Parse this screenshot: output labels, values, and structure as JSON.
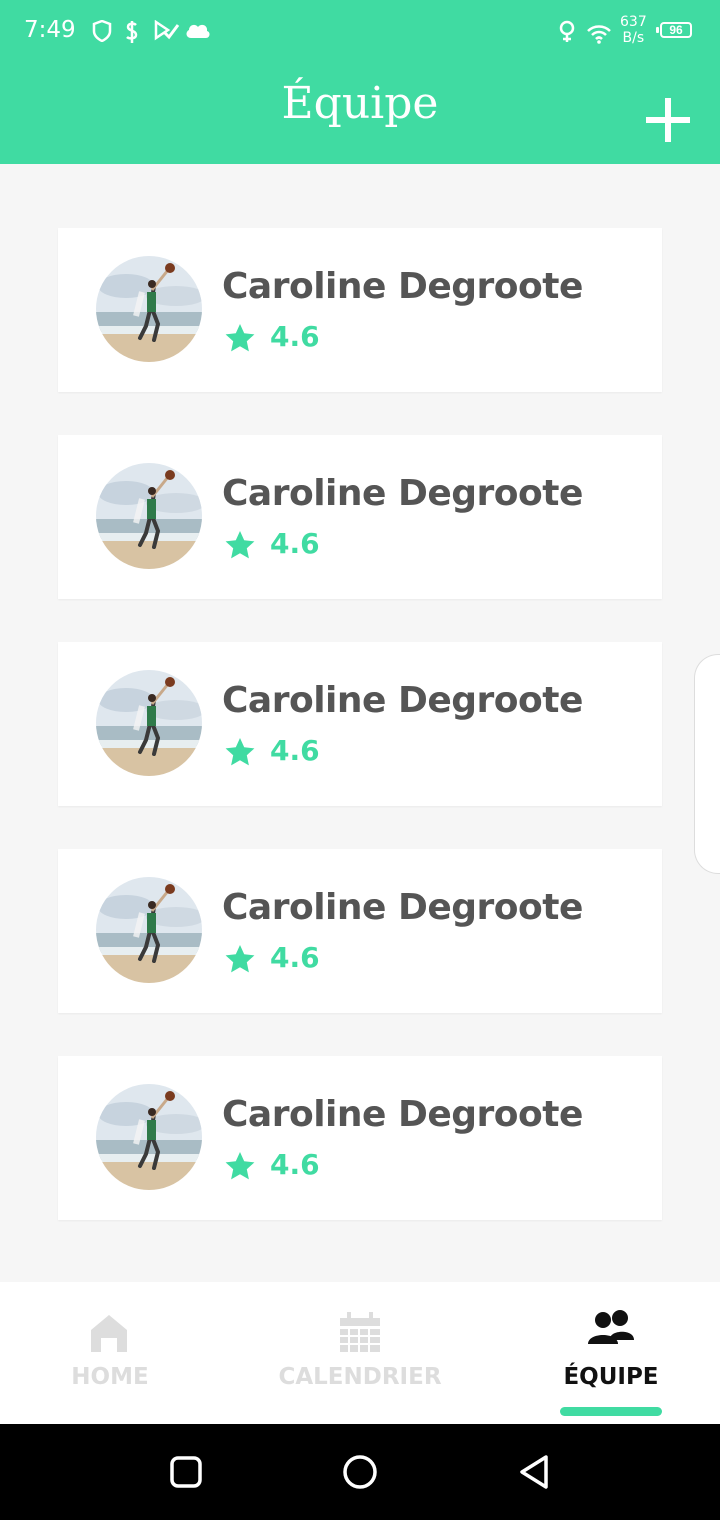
{
  "status_bar": {
    "time": "7:49",
    "speed_value": "637",
    "speed_unit": "B/s",
    "battery": "96"
  },
  "header": {
    "title": "Équipe"
  },
  "team": [
    {
      "name": "Caroline Degroote",
      "rating": "4.6"
    },
    {
      "name": "Caroline Degroote",
      "rating": "4.6"
    },
    {
      "name": "Caroline Degroote",
      "rating": "4.6"
    },
    {
      "name": "Caroline Degroote",
      "rating": "4.6"
    },
    {
      "name": "Caroline Degroote",
      "rating": "4.6"
    }
  ],
  "bottom_nav": {
    "items": [
      {
        "label": "HOME",
        "icon": "home-icon"
      },
      {
        "label": "CALENDRIER",
        "icon": "calendar-icon"
      },
      {
        "label": "ÉQUIPE",
        "icon": "team-icon",
        "active": true
      }
    ]
  },
  "colors": {
    "accent": "#40dba2",
    "text_dark": "#555555",
    "inactive": "#dddddd"
  }
}
